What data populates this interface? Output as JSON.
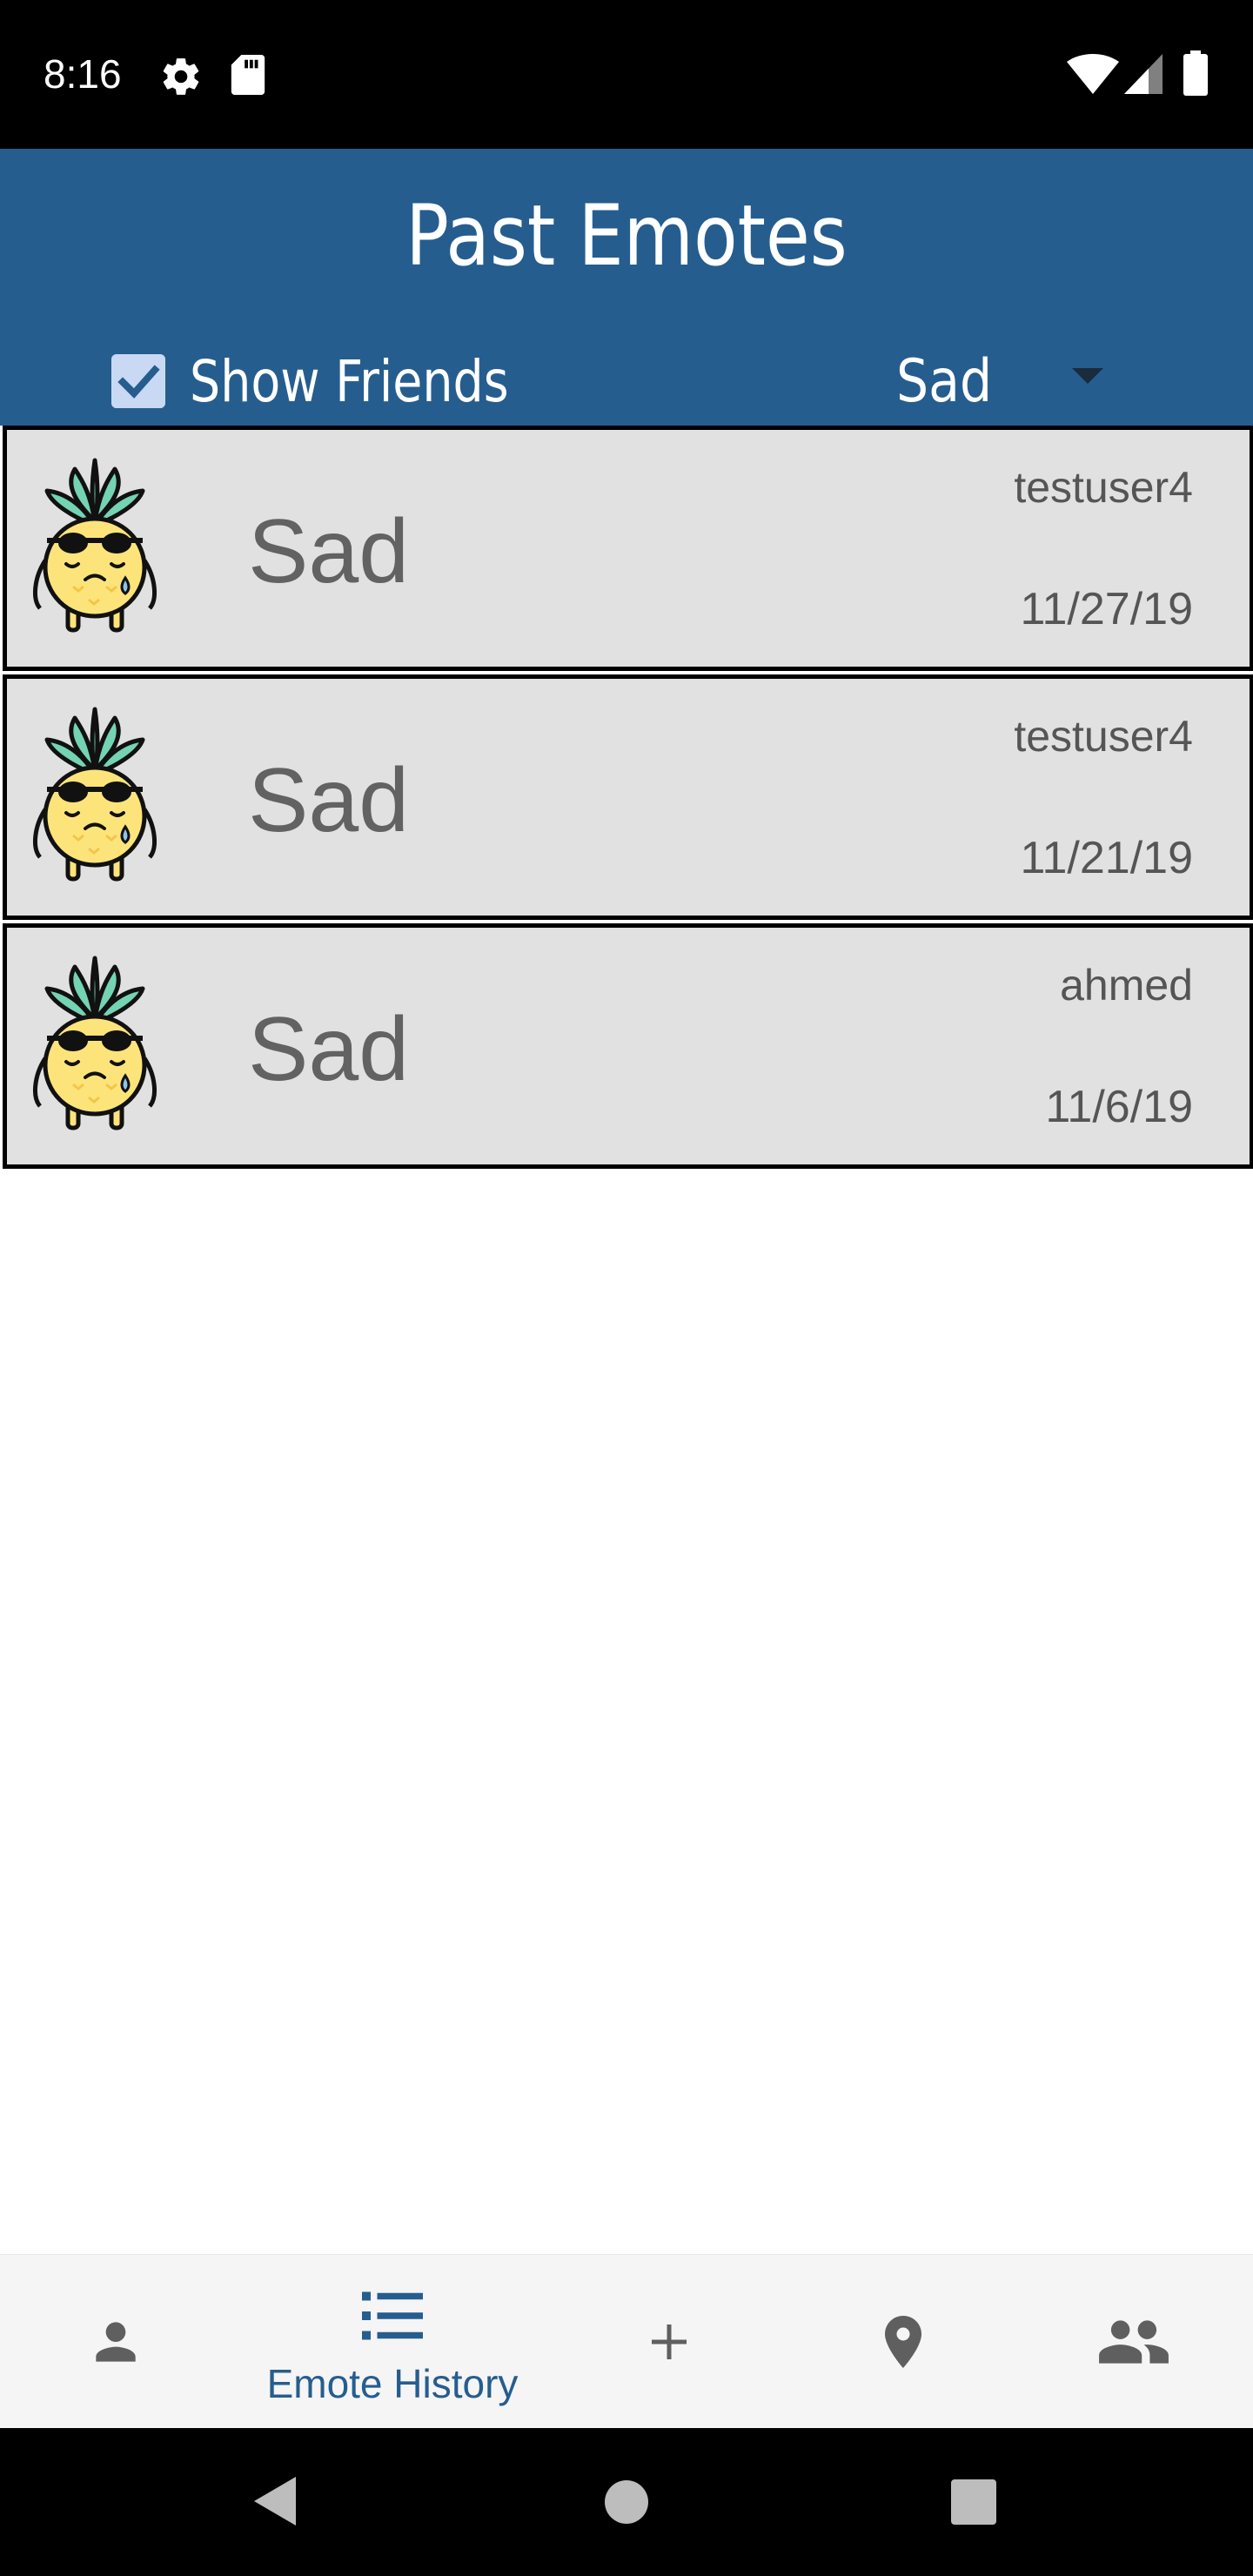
{
  "status_bar": {
    "time": "8:16",
    "icons": [
      "gear-icon",
      "sd-card-icon",
      "wifi-icon",
      "signal-icon",
      "battery-icon"
    ]
  },
  "header": {
    "title": "Past Emotes",
    "show_friends_label": "Show Friends",
    "show_friends_checked": true,
    "filter_value": "Sad"
  },
  "emotes": [
    {
      "emotion": "Sad",
      "user": "testuser4",
      "date": "11/27/19",
      "icon": "sad-pineapple-icon"
    },
    {
      "emotion": "Sad",
      "user": "testuser4",
      "date": "11/21/19",
      "icon": "sad-pineapple-icon"
    },
    {
      "emotion": "Sad",
      "user": "ahmed",
      "date": "11/6/19",
      "icon": "sad-pineapple-icon"
    }
  ],
  "bottom_nav": {
    "items": [
      {
        "icon": "person-icon",
        "label": ""
      },
      {
        "icon": "list-icon",
        "label": "Emote History",
        "active": true
      },
      {
        "icon": "plus-icon",
        "label": ""
      },
      {
        "icon": "location-pin-icon",
        "label": ""
      },
      {
        "icon": "people-icon",
        "label": ""
      }
    ]
  },
  "colors": {
    "header": "#265d8f",
    "card_bg": "#e1e1e1",
    "active_nav": "#265d8f",
    "inactive_nav": "#5f5f5f"
  }
}
